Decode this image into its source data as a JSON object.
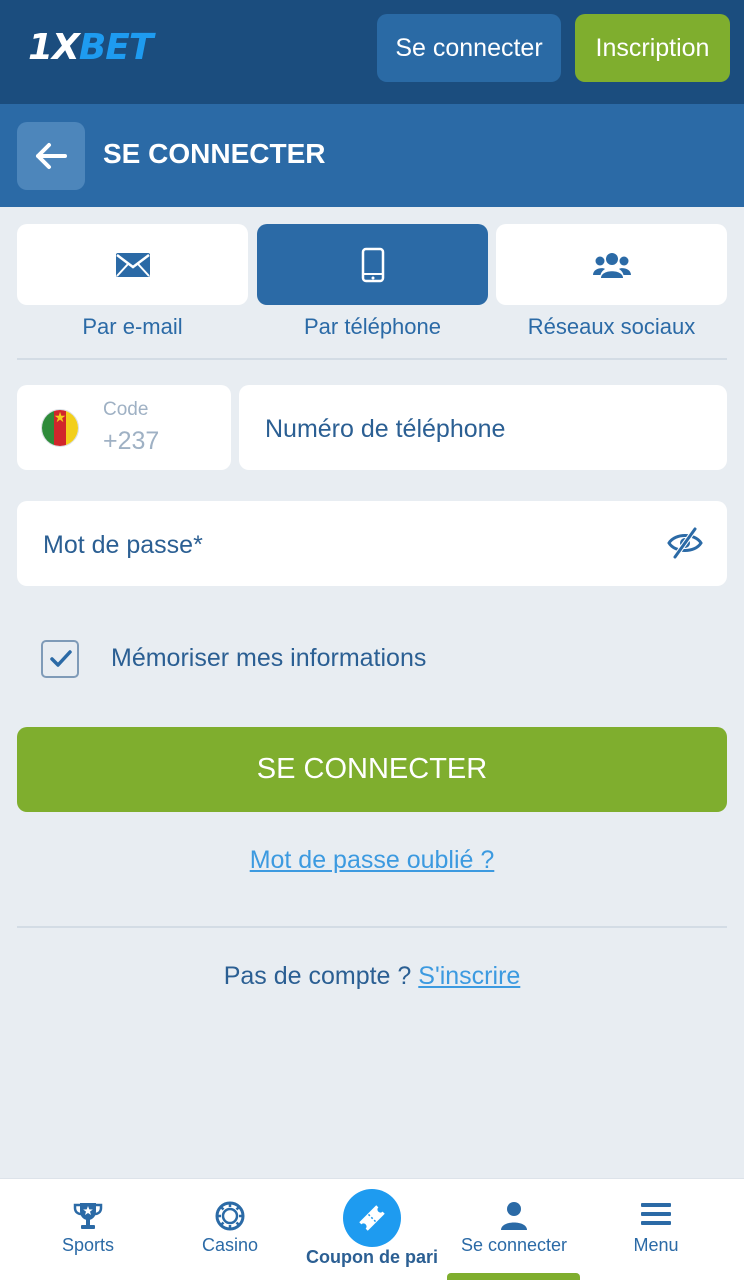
{
  "header": {
    "logo_prefix": "1X",
    "logo_suffix": "BET",
    "login_label": "Se connecter",
    "register_label": "Inscription"
  },
  "subheader": {
    "back_icon": "arrow-left-icon",
    "title": "SE CONNECTER"
  },
  "login_methods": [
    {
      "label": "Par e-mail",
      "icon": "envelope-icon",
      "active": false
    },
    {
      "label": "Par téléphone",
      "icon": "smartphone-icon",
      "active": true
    },
    {
      "label": "Réseaux sociaux",
      "icon": "users-icon",
      "active": false
    }
  ],
  "form": {
    "country_code_label": "Code",
    "country_code_value": "+237",
    "country_flag": "cameroon-flag",
    "phone_placeholder": "Numéro de téléphone",
    "password_placeholder": "Mot de passe*",
    "remember_label": "Mémoriser mes informations",
    "remember_checked": true,
    "submit_label": "SE CONNECTER",
    "forgot_label": "Mot de passe oublié ?",
    "no_account_text": "Pas de compte ?",
    "signup_link": "S'inscrire"
  },
  "bottom_nav": [
    {
      "label": "Sports",
      "icon": "trophy-icon"
    },
    {
      "label": "Casino",
      "icon": "casino-chip-icon"
    },
    {
      "label": "Coupon de pari",
      "icon": "ticket-icon"
    },
    {
      "label": "Se connecter",
      "icon": "user-icon",
      "active": true
    },
    {
      "label": "Menu",
      "icon": "hamburger-icon"
    }
  ],
  "colors": {
    "header_bg": "#1b4d7e",
    "subheader_bg": "#2b6aa6",
    "accent_green": "#7fae2e",
    "link_blue": "#3c9ae0",
    "page_bg": "#e8edf2"
  }
}
